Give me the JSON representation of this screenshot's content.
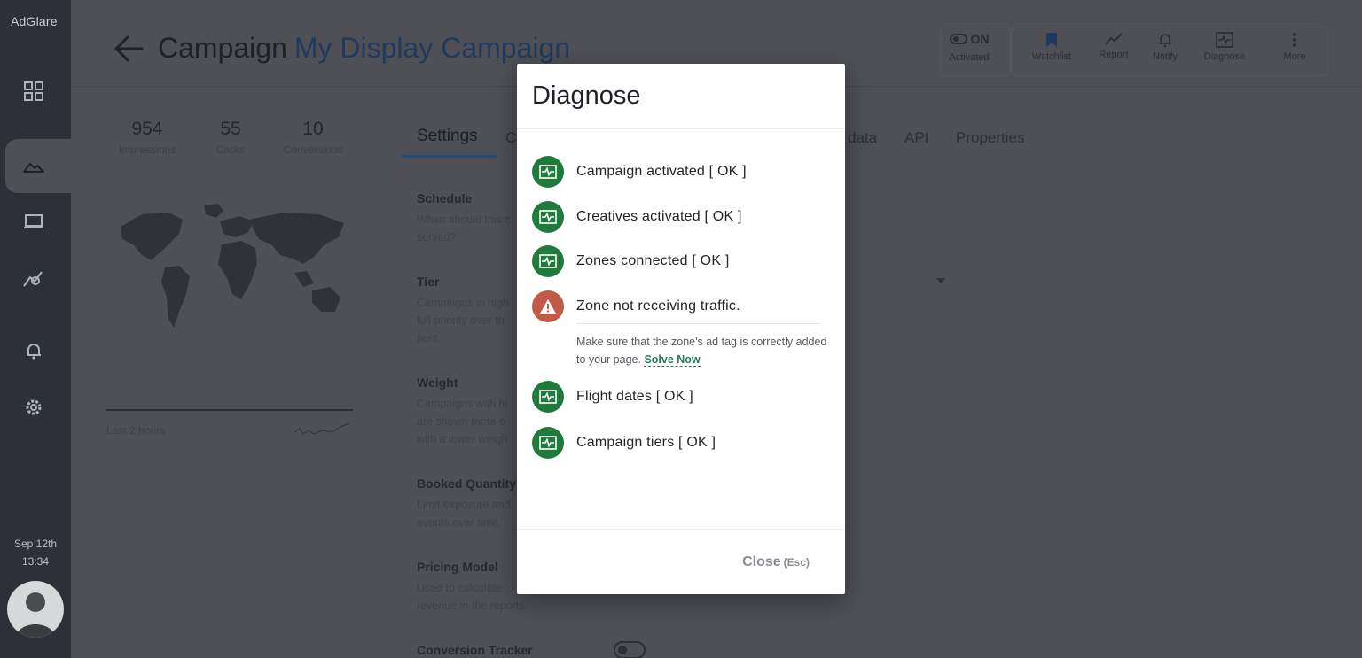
{
  "sidebar": {
    "logo": "AdGlare",
    "date": "Sep 12th",
    "time": "13:34",
    "icons": [
      "dashboard-icon",
      "campaigns-icon",
      "monitor-icon",
      "analytics-icon",
      "alerts-icon",
      "settings-icon"
    ]
  },
  "header": {
    "title_prefix": "Campaign",
    "campaign_name": "My Display Campaign"
  },
  "toolbar": {
    "status": "ON",
    "status_label": "Activated",
    "watchlist": "Watchlist",
    "report": "Report",
    "notify": "Notify",
    "diagnose": "Diagnose",
    "more": "More"
  },
  "stats": [
    {
      "value": "954",
      "label": "Impressions"
    },
    {
      "value": "55",
      "label": "Clicks"
    },
    {
      "value": "10",
      "label": "Conversions"
    }
  ],
  "chart_footer": "Last 2 hours",
  "tabs": [
    "Settings",
    "C",
    "data",
    "API",
    "Properties"
  ],
  "settings": [
    {
      "name": "Schedule",
      "desc1": "When should this c",
      "desc2": "served?"
    },
    {
      "name": "Tier",
      "desc1": "Campaigns in high",
      "desc2": "full priority over th",
      "desc3": "tiers."
    },
    {
      "name": "Weight",
      "desc1": "Campaigns with hi",
      "desc2": "are shown more o",
      "desc3": "with a lower weigh"
    },
    {
      "name": "Booked Quantity",
      "desc1": "Limit exposure and",
      "desc2": "events over time."
    },
    {
      "name": "Pricing Model",
      "desc1": "Used to calculate",
      "desc2": "revenue in the reports."
    },
    {
      "name": "Conversion Tracker"
    }
  ],
  "modal": {
    "title": "Diagnose",
    "checks": [
      {
        "text": "Campaign activated [ OK ]",
        "status": "ok"
      },
      {
        "text": "Creatives activated [ OK ]",
        "status": "ok"
      },
      {
        "text": "Zones connected [ OK ]",
        "status": "ok"
      },
      {
        "text": "Zone not receiving traffic.",
        "status": "warning"
      },
      {
        "text": "Flight dates [ OK ]",
        "status": "ok"
      },
      {
        "text": "Campaign tiers [ OK ]",
        "status": "ok"
      }
    ],
    "warning_help": "Make sure that the zone's ad tag is correctly added to your page.",
    "solve_link": "Solve Now",
    "close_label": "Close",
    "close_hint": "(Esc)"
  },
  "colors": {
    "ok": "#1f7a3c",
    "warning": "#c25a48",
    "link": "#2a7a5e",
    "campaign_name": "#1f3a5e"
  }
}
